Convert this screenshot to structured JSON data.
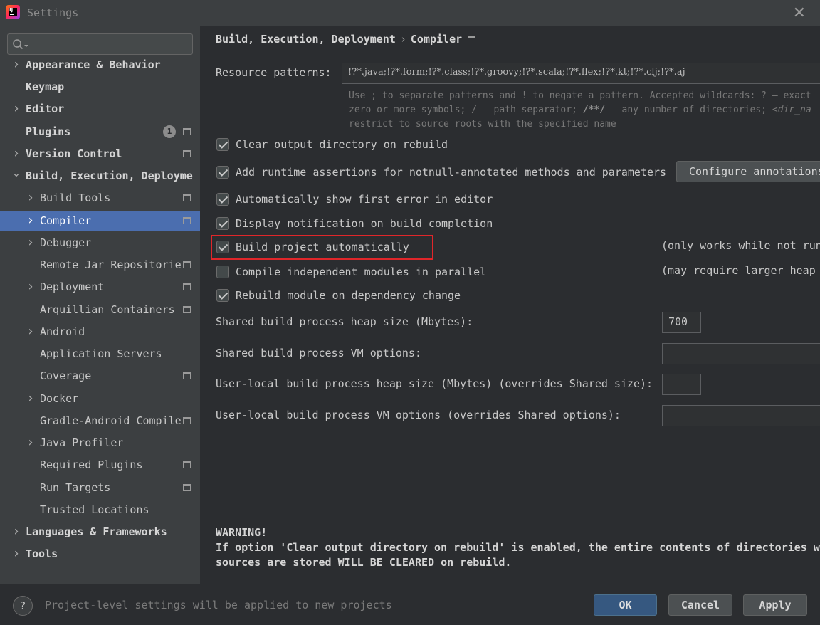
{
  "window": {
    "title": "Settings",
    "close_glyph": "✕",
    "app_icon": "intellij-idea-icon",
    "app_icon_text": "IJ"
  },
  "search": {
    "placeholder": "",
    "icon": "search-icon"
  },
  "sidebar": {
    "items": [
      {
        "label": "Appearance & Behavior",
        "level": 0,
        "chevron": "right",
        "badge": "",
        "project_icon": false,
        "selected": false
      },
      {
        "label": "Keymap",
        "level": 0,
        "chevron": "",
        "badge": "",
        "project_icon": false,
        "selected": false
      },
      {
        "label": "Editor",
        "level": 0,
        "chevron": "right",
        "badge": "",
        "project_icon": false,
        "selected": false
      },
      {
        "label": "Plugins",
        "level": 0,
        "chevron": "",
        "badge": "1",
        "project_icon": true,
        "selected": false
      },
      {
        "label": "Version Control",
        "level": 0,
        "chevron": "right",
        "badge": "",
        "project_icon": true,
        "selected": false
      },
      {
        "label": "Build, Execution, Deployme",
        "level": 0,
        "chevron": "down",
        "badge": "",
        "project_icon": false,
        "selected": false
      },
      {
        "label": "Build Tools",
        "level": 1,
        "chevron": "right",
        "badge": "",
        "project_icon": true,
        "selected": false
      },
      {
        "label": "Compiler",
        "level": 1,
        "chevron": "right",
        "badge": "",
        "project_icon": true,
        "selected": true
      },
      {
        "label": "Debugger",
        "level": 1,
        "chevron": "right",
        "badge": "",
        "project_icon": false,
        "selected": false
      },
      {
        "label": "Remote Jar Repositorie",
        "level": 1,
        "chevron": "",
        "badge": "",
        "project_icon": true,
        "selected": false
      },
      {
        "label": "Deployment",
        "level": 1,
        "chevron": "right",
        "badge": "",
        "project_icon": true,
        "selected": false
      },
      {
        "label": "Arquillian Containers",
        "level": 1,
        "chevron": "",
        "badge": "",
        "project_icon": true,
        "selected": false
      },
      {
        "label": "Android",
        "level": 1,
        "chevron": "right",
        "badge": "",
        "project_icon": false,
        "selected": false
      },
      {
        "label": "Application Servers",
        "level": 1,
        "chevron": "",
        "badge": "",
        "project_icon": false,
        "selected": false
      },
      {
        "label": "Coverage",
        "level": 1,
        "chevron": "",
        "badge": "",
        "project_icon": true,
        "selected": false
      },
      {
        "label": "Docker",
        "level": 1,
        "chevron": "right",
        "badge": "",
        "project_icon": false,
        "selected": false
      },
      {
        "label": "Gradle-Android Compile",
        "level": 1,
        "chevron": "",
        "badge": "",
        "project_icon": true,
        "selected": false
      },
      {
        "label": "Java Profiler",
        "level": 1,
        "chevron": "right",
        "badge": "",
        "project_icon": false,
        "selected": false
      },
      {
        "label": "Required Plugins",
        "level": 1,
        "chevron": "",
        "badge": "",
        "project_icon": true,
        "selected": false
      },
      {
        "label": "Run Targets",
        "level": 1,
        "chevron": "",
        "badge": "",
        "project_icon": true,
        "selected": false
      },
      {
        "label": "Trusted Locations",
        "level": 1,
        "chevron": "",
        "badge": "",
        "project_icon": false,
        "selected": false
      },
      {
        "label": "Languages & Frameworks",
        "level": 0,
        "chevron": "right",
        "badge": "",
        "project_icon": false,
        "selected": false
      },
      {
        "label": "Tools",
        "level": 0,
        "chevron": "right",
        "badge": "",
        "project_icon": false,
        "selected": false
      }
    ]
  },
  "content": {
    "breadcrumb": {
      "parent": "Build, Execution, Deployment",
      "separator": "›",
      "current": "Compiler"
    },
    "resource_patterns": {
      "label": "Resource patterns:",
      "value": "!?*.java;!?*.form;!?*.class;!?*.groovy;!?*.scala;!?*.flex;!?*.kt;!?*.clj;!?*.aj",
      "hint_line1": "Use ; to separate patterns and ! to negate a pattern. Accepted wildcards: ? — exact",
      "hint_line2_a": "zero or more symbols; / — path separator; ",
      "hint_line2_b": "/**/",
      "hint_line2_c": " — any number of directories; ",
      "hint_line2_d": "<dir_na",
      "hint_line3": "restrict to source roots with the specified name"
    },
    "options": {
      "clear_output": {
        "label": "Clear output directory on rebuild",
        "checked": true
      },
      "runtime_assertions": {
        "label": "Add runtime assertions for notnull-annotated methods and parameters",
        "checked": true
      },
      "configure_annotations": "Configure annotations...",
      "show_first_error": {
        "label": "Automatically show first error in editor",
        "checked": true
      },
      "display_notification": {
        "label": "Display notification on build completion",
        "checked": true
      },
      "build_automatically": {
        "label": "Build project automatically",
        "checked": true,
        "note": "(only works while not running / debugging)"
      },
      "compile_parallel": {
        "label": "Compile independent modules in parallel",
        "checked": false,
        "note": "(may require larger heap size)"
      },
      "rebuild_on_dependency": {
        "label": "Rebuild module on dependency change",
        "checked": true
      }
    },
    "heap": {
      "shared_heap_label": "Shared build process heap size (Mbytes):",
      "shared_heap_value": "700",
      "shared_vm_label": "Shared build process VM options:",
      "shared_vm_value": "",
      "local_heap_label": "User-local build process heap size (Mbytes) (overrides Shared size):",
      "local_heap_value": "",
      "local_vm_label": "User-local build process VM options (overrides Shared options):",
      "local_vm_value": ""
    },
    "warning": {
      "title": "WARNING!",
      "line1": "If option 'Clear output directory on rebuild' is enabled, the entire contents of directories wh",
      "line2": "sources are stored WILL BE CLEARED on rebuild."
    }
  },
  "footer": {
    "help": "?",
    "note": "Project-level settings will be applied to new projects",
    "ok": "OK",
    "cancel": "Cancel",
    "apply": "Apply"
  },
  "colors": {
    "selection": "#4b6eaf",
    "primary_button": "#365880",
    "highlight_frame": "#e0262a"
  }
}
